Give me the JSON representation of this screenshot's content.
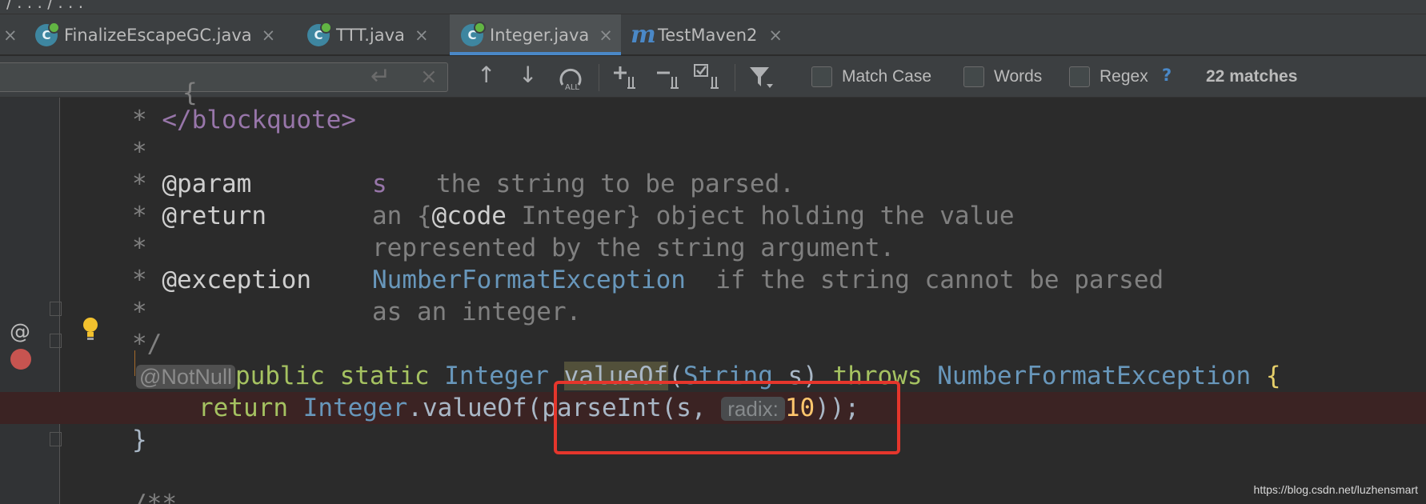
{
  "breadcrumb": {
    "visible": "/ . . . / . . ."
  },
  "tabs": [
    {
      "label": "FinalizeEscapeGC.java",
      "icon": "java-class-icon",
      "active": false
    },
    {
      "label": "TTT.java",
      "icon": "java-class-icon",
      "active": false
    },
    {
      "label": "Integer.java",
      "icon": "java-class-icon",
      "active": true
    },
    {
      "label": "TestMaven2",
      "icon": "maven-icon",
      "active": false
    }
  ],
  "tab_close_glyph": "×",
  "find": {
    "search_value": "",
    "enter_glyph": "↵",
    "clear_glyph": "×",
    "prev_glyph": "↑",
    "next_glyph": "↓",
    "match_case": "Match Case",
    "words": "Words",
    "regex": "Regex",
    "help": "?",
    "matches": "22 matches"
  },
  "editor": {
    "gutter_marker": "@",
    "annotation": "@NotNull",
    "hint_label": "radix:",
    "comment_lines": {
      "l1_star": "*",
      "l1_tag": "</blockquote>",
      "l2_star": "*",
      "l3_star": "*",
      "l3_tag": "@param",
      "l3_name": "s",
      "l3_text": "the string to be parsed.",
      "l4_star": "*",
      "l4_tag": "@return",
      "l4_text1": "an {",
      "l4_code": "@code",
      "l4_text2": " Integer} object holding the value",
      "l5_star": "*",
      "l5_text": "represented by the string argument.",
      "l6_star": "*",
      "l6_tag": "@exception",
      "l6_link": "NumberFormatException",
      "l6_text": "if the string cannot be parsed",
      "l7_star": "*",
      "l7_text": "as an integer.",
      "l8_end": "*/"
    },
    "signature": {
      "public": "public",
      "static": "static",
      "type": "Integer",
      "name": "valueOf",
      "paren_open": "(",
      "param_type": "String",
      "param": " s",
      "paren_close": ")",
      "throws": "throws",
      "ex": "NumberFormatException",
      "brace": "{"
    },
    "body": {
      "return": "return",
      "type": "Integer",
      "dot_call": ".valueOf",
      "open": "(",
      "call": "parseInt(s, ",
      "num": "10",
      "close": "));"
    },
    "closing_brace": "}",
    "next_doc": "/**"
  },
  "watermark": "https://blog.csdn.net/luzhensmart",
  "colors": {
    "accent": "#4a88c7",
    "breakpoint": "#c75450",
    "callout": "#e5362c"
  }
}
